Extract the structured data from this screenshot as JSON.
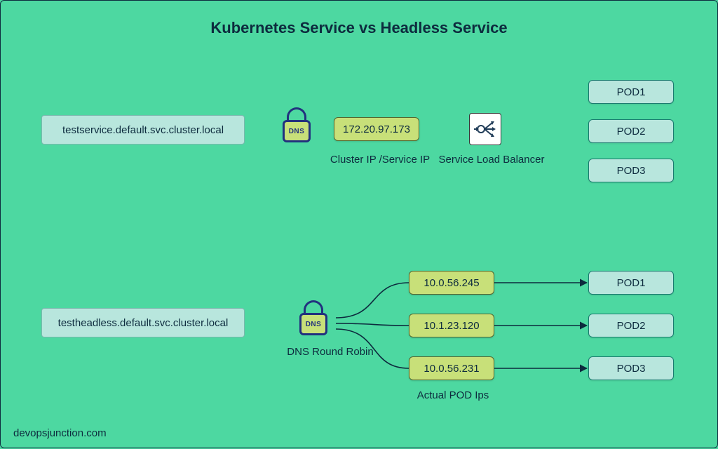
{
  "title": "Kubernetes Service vs Headless Service",
  "attribution": "devopsjunction.com",
  "dns_label": "DNS",
  "service": {
    "dns_name": "testservice.default.svc.cluster.local",
    "cluster_ip": "172.20.97.173",
    "cluster_ip_label": "Cluster IP /Service IP",
    "lb_label": "Service Load Balancer",
    "pods": [
      "POD1",
      "POD2",
      "POD3"
    ]
  },
  "headless": {
    "dns_name": "testheadless.default.svc.cluster.local",
    "dns_rr_label": "DNS Round Robin",
    "pod_ips_label": "Actual POD Ips",
    "ips": [
      "10.0.56.245",
      "10.1.23.120",
      "10.0.56.231"
    ],
    "pods": [
      "POD1",
      "POD2",
      "POD3"
    ]
  }
}
